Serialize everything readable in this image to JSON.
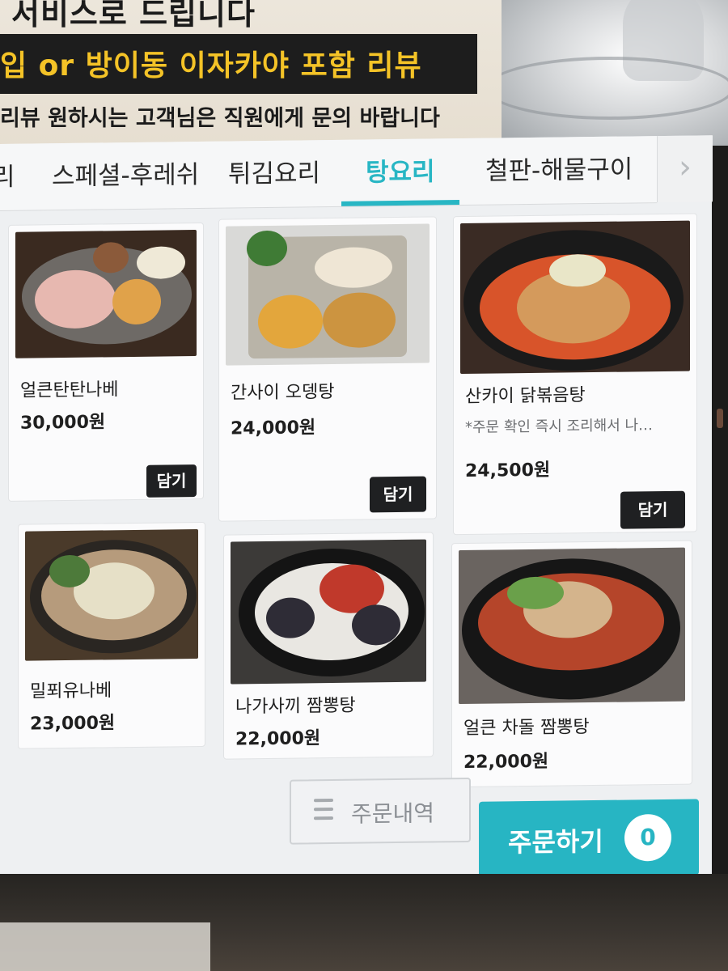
{
  "banner": {
    "line1": "서비스로 드립니다",
    "line2": "입 or 방이동 이자카야 포함 리뷰",
    "line3": "리뷰 원하시는 고객님은 직원에게 문의 바랍니다"
  },
  "tabs": [
    {
      "label": "리"
    },
    {
      "label": "스페셜-후레쉬"
    },
    {
      "label": "튀김요리"
    },
    {
      "label": "탕요리",
      "active": true
    },
    {
      "label": "철판-해물구이"
    }
  ],
  "tab_next_icon": "chevron-right-icon",
  "menu": [
    {
      "name": "얼큰탄탄나베",
      "price": "30,000원",
      "add_label": "담기"
    },
    {
      "name": "간사이 오뎅탕",
      "price": "24,000원",
      "add_label": "담기"
    },
    {
      "name": "산카이 닭볶음탕",
      "desc": "*주문 확인 즉시 조리해서 나…",
      "price": "24,500원",
      "add_label": "담기"
    },
    {
      "name": "밀푀유나베",
      "price": "23,000원"
    },
    {
      "name": "나가사끼 짬뽕탕",
      "price": "22,000원"
    },
    {
      "name": "얼큰 차돌 짬뽕탕",
      "price": "22,000원"
    }
  ],
  "footer": {
    "history_label": "주문내역",
    "order_label": "주문하기",
    "cart_count": "0"
  },
  "colors": {
    "accent": "#27b5c3",
    "banner_text": "#f4c327"
  }
}
